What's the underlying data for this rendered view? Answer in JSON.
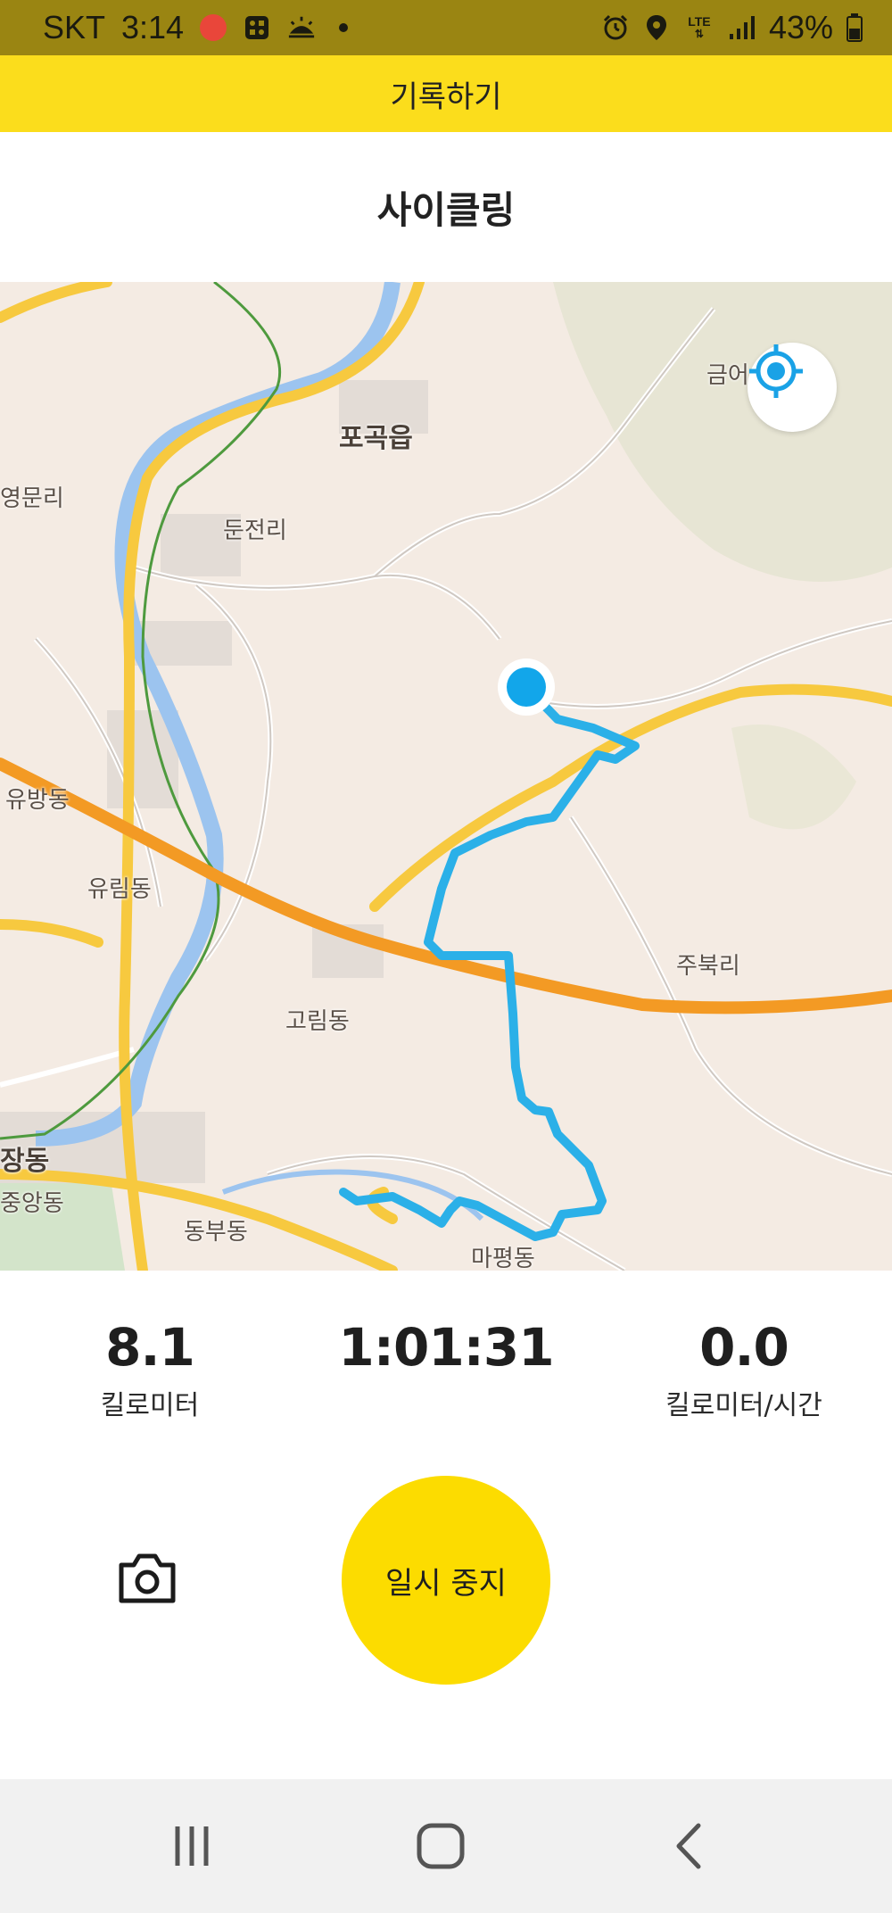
{
  "status_bar": {
    "carrier": "SKT",
    "time": "3:14",
    "network": "LTE",
    "battery": "43%",
    "icons": [
      "record-dot-icon",
      "app-badge-icon",
      "weather-icon",
      "notification-dot-icon",
      "alarm-icon",
      "location-icon",
      "lte-icon",
      "signal-icon",
      "battery-icon"
    ]
  },
  "app_bar": {
    "title": "기록하기"
  },
  "activity": {
    "type": "사이클링"
  },
  "map": {
    "labels": [
      "포곡읍",
      "둔전리",
      "영문리",
      "유방동",
      "유림동",
      "고림동",
      "주북리",
      "장동",
      "중앙동",
      "동부동",
      "마평동",
      "금어"
    ],
    "locate_icon": "crosshair-icon",
    "route_color": "#2bb0e8"
  },
  "stats": {
    "distance": {
      "value": "8.1",
      "unit": "킬로미터"
    },
    "duration": {
      "value": "1:01:31"
    },
    "speed": {
      "value": "0.0",
      "unit": "킬로미터/시간"
    }
  },
  "controls": {
    "pause_label": "일시 중지",
    "camera_icon": "camera-icon",
    "accent_color": "#fcdc00"
  },
  "nav_bar": {
    "icons": [
      "recent-apps-icon",
      "home-icon",
      "back-icon"
    ]
  }
}
